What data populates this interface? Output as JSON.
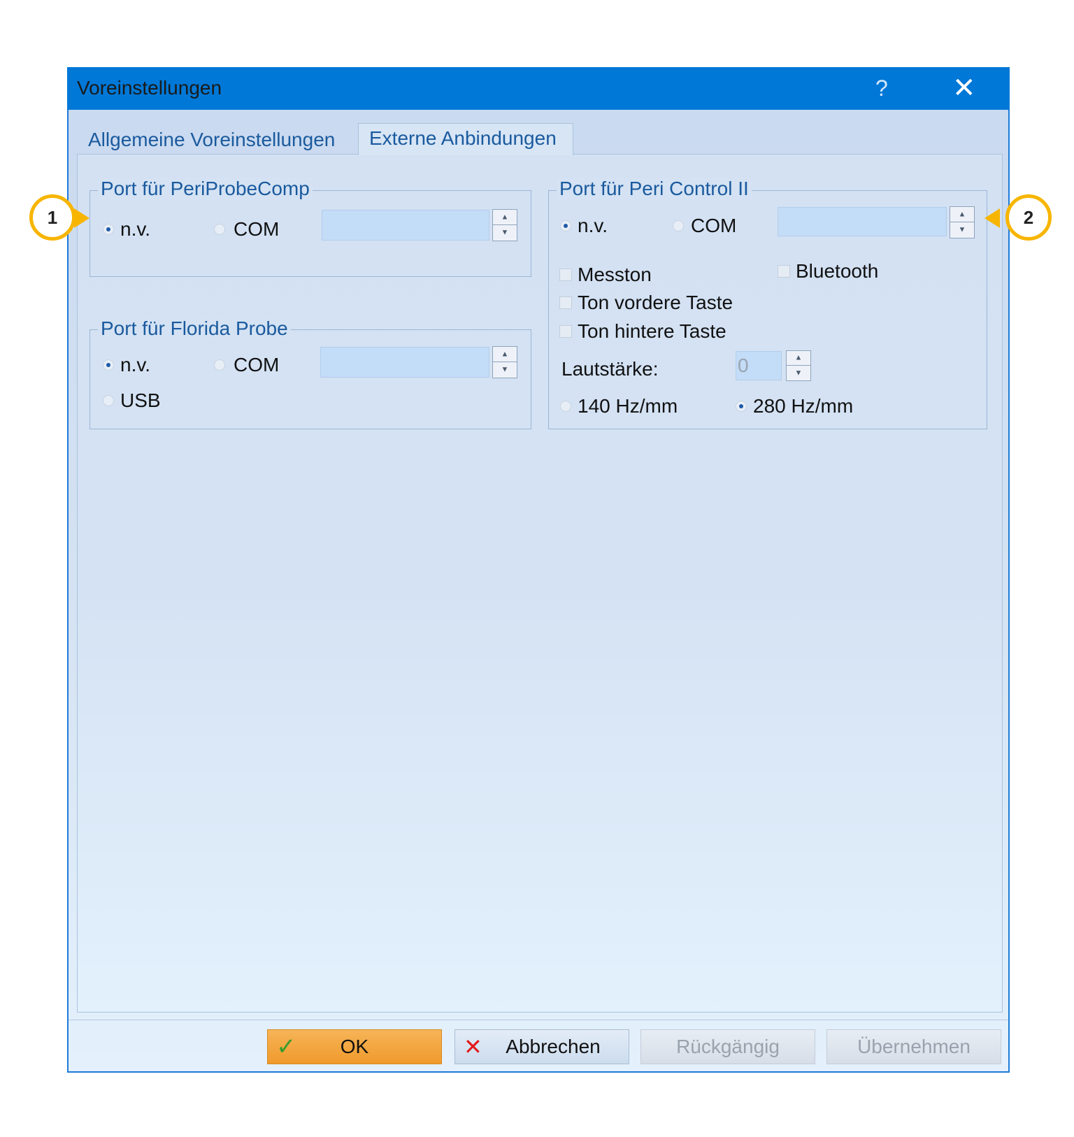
{
  "window": {
    "title": "Voreinstellungen",
    "help_glyph": "?",
    "close_glyph": "✕"
  },
  "tabs": [
    {
      "label": "Allgemeine Voreinstellungen",
      "active": false
    },
    {
      "label": "Externe Anbindungen",
      "active": true
    }
  ],
  "periprobecomp": {
    "legend": "Port für PeriProbeComp",
    "radio_nv": "n.v.",
    "radio_com": "COM",
    "selected": "n.v.",
    "com_value": ""
  },
  "florida": {
    "legend": "Port für Florida Probe",
    "radio_nv": "n.v.",
    "radio_com": "COM",
    "radio_usb": "USB",
    "selected": "n.v.",
    "com_value": ""
  },
  "pericontrol": {
    "legend": "Port für Peri Control II",
    "radio_nv": "n.v.",
    "radio_com": "COM",
    "selected": "n.v.",
    "com_value": "",
    "messton": "Messton",
    "bluetooth": "Bluetooth",
    "ton_vordere": "Ton vordere Taste",
    "ton_hintere": "Ton hintere Taste",
    "volume_label": "Lautstärke:",
    "volume_value": "0",
    "freq_140": "140 Hz/mm",
    "freq_280": "280 Hz/mm",
    "freq_selected": "280 Hz/mm"
  },
  "buttons": {
    "ok": "OK",
    "cancel": "Abbrechen",
    "undo": "Rückgängig",
    "apply": "Übernehmen"
  },
  "callouts": [
    "1",
    "2"
  ],
  "colors": {
    "titlebar": "#0078d7",
    "accent_text": "#1a5a9e",
    "ok_button": "#f3a53d",
    "marker": "#f7b500",
    "cancel_icon": "#e21b1b",
    "ok_icon": "#3a9b2c"
  }
}
